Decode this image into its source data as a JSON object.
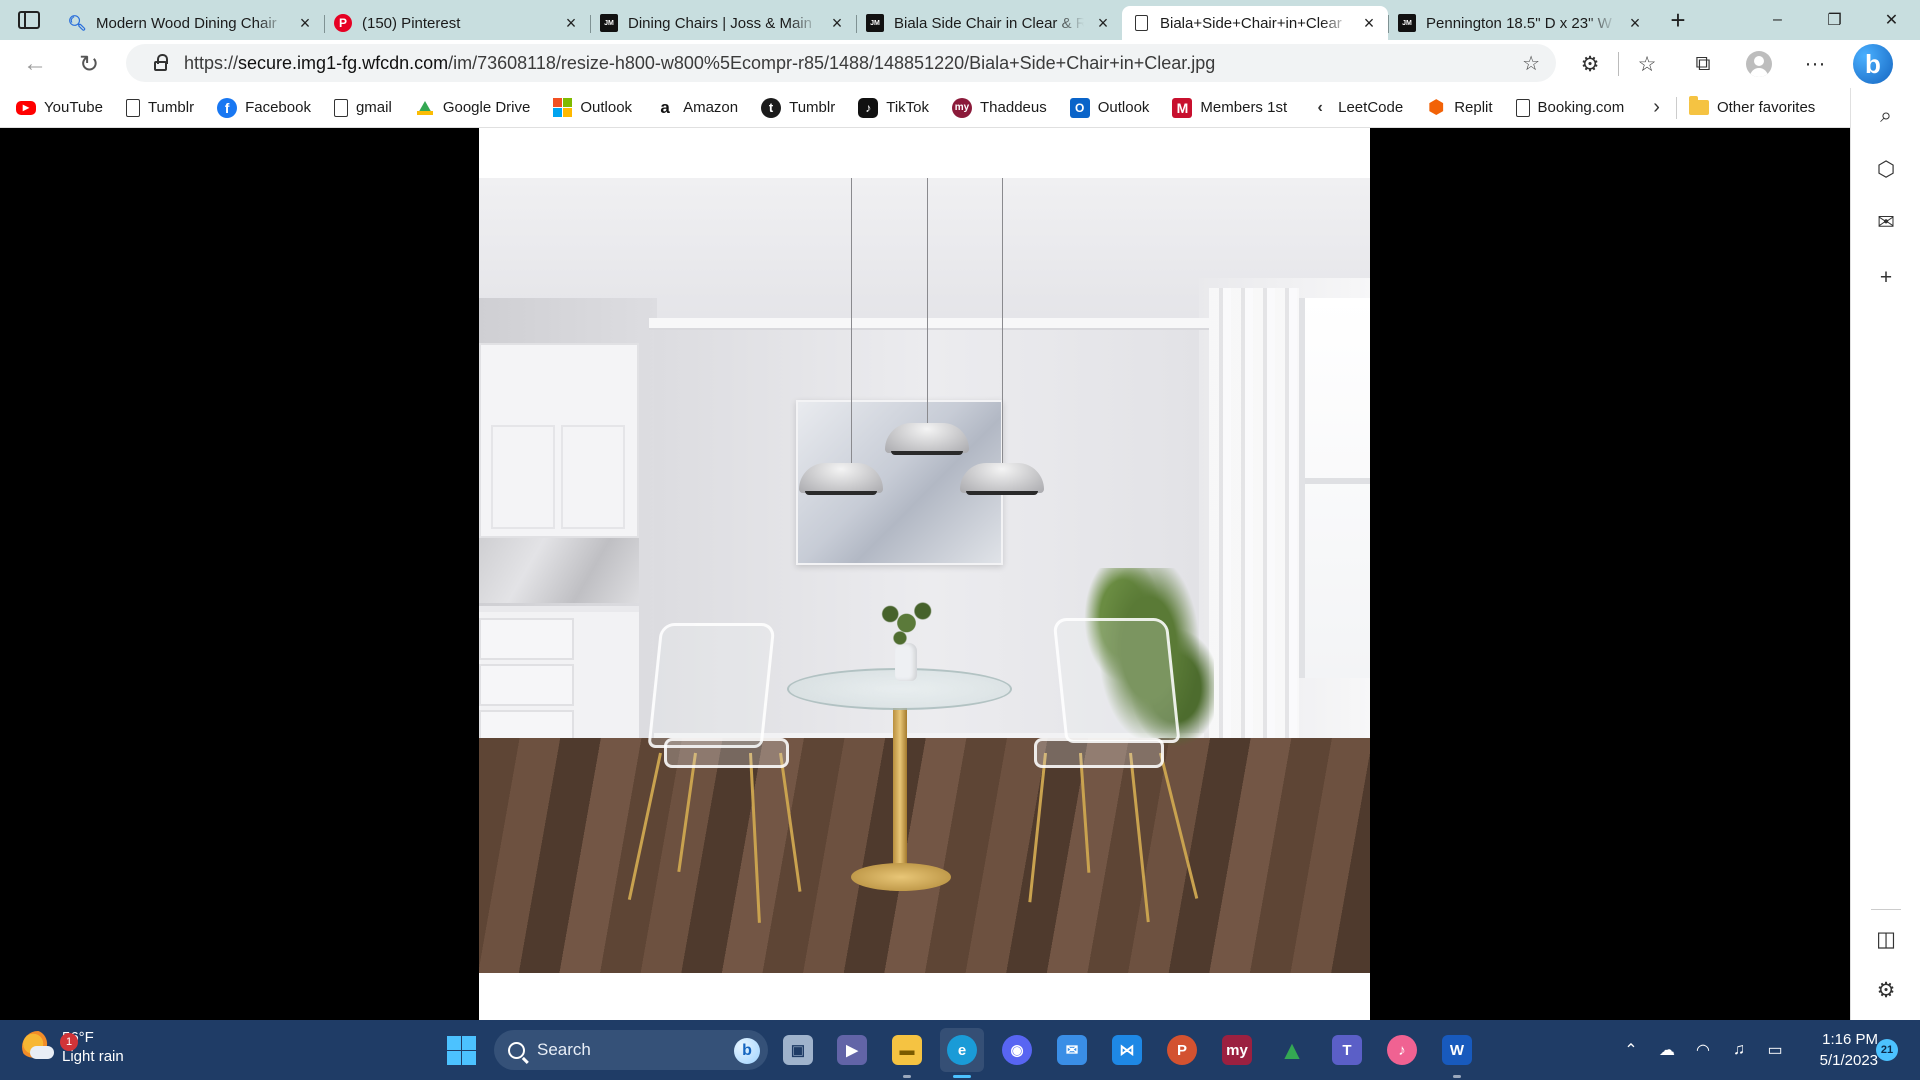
{
  "browser": {
    "tabs": [
      {
        "title": "Modern Wood Dining Chair",
        "favicon": "search-icon",
        "active": false
      },
      {
        "title": "(150) Pinterest",
        "favicon": "pinterest-icon",
        "active": false
      },
      {
        "title": "Dining Chairs | Joss & Main",
        "favicon": "joss-main-icon",
        "active": false
      },
      {
        "title": "Biala Side Chair in Clear & R",
        "favicon": "joss-main-icon",
        "active": false
      },
      {
        "title": "Biala+Side+Chair+in+Clear",
        "favicon": "document-icon",
        "active": true
      },
      {
        "title": "Pennington 18.5\" D x 23\" W",
        "favicon": "joss-main-icon",
        "active": false
      }
    ],
    "new_tab": "+",
    "window_controls": {
      "minimize": "–",
      "restore": "❐",
      "close": "✕"
    },
    "address": {
      "prefix": "https://",
      "host": "secure.img1-fg.wfcdn.com",
      "path": "/im/73608118/resize-h800-w800%5Ecompr-r85/1488/148851220/Biala+Side+Chair+in+Clear.jpg"
    },
    "favorites": [
      {
        "label": "YouTube",
        "icon": "youtube-icon"
      },
      {
        "label": "Tumblr",
        "icon": "document-icon"
      },
      {
        "label": "Facebook",
        "icon": "facebook-icon"
      },
      {
        "label": "gmail",
        "icon": "document-icon"
      },
      {
        "label": "Google Drive",
        "icon": "google-drive-icon"
      },
      {
        "label": "Outlook",
        "icon": "microsoft-icon"
      },
      {
        "label": "Amazon",
        "icon": "amazon-icon"
      },
      {
        "label": "Tumblr",
        "icon": "tumblr-icon"
      },
      {
        "label": "TikTok",
        "icon": "tiktok-icon"
      },
      {
        "label": "Thaddeus",
        "icon": "my-icon"
      },
      {
        "label": "Outlook",
        "icon": "outlook-icon"
      },
      {
        "label": "Members 1st",
        "icon": "members-1st-icon"
      },
      {
        "label": "LeetCode",
        "icon": "leetcode-icon"
      },
      {
        "label": "Replit",
        "icon": "replit-icon"
      },
      {
        "label": "Booking.com",
        "icon": "document-icon"
      }
    ],
    "other_favorites": "Other favorites"
  },
  "taskbar": {
    "weather": {
      "temp": "56°F",
      "condition": "Light rain",
      "badge": "1"
    },
    "search_placeholder": "Search",
    "clock": {
      "time": "1:16 PM",
      "date": "5/1/2023"
    },
    "notifications": "21",
    "apps": [
      {
        "name": "task-view",
        "glyph": "▣",
        "color": "#9fb3cc"
      },
      {
        "name": "teams-meet",
        "glyph": "▶",
        "color": "#6264a7"
      },
      {
        "name": "file-explorer",
        "glyph": "▬",
        "color": "#f5c342"
      },
      {
        "name": "edge",
        "glyph": "e",
        "color": "#1a9bd7"
      },
      {
        "name": "discord",
        "glyph": "◉",
        "color": "#5865f2"
      },
      {
        "name": "mail",
        "glyph": "✉",
        "color": "#3a8ee6"
      },
      {
        "name": "vscode",
        "glyph": "⋈",
        "color": "#1e88e5"
      },
      {
        "name": "powerpoint",
        "glyph": "P",
        "color": "#d35230"
      },
      {
        "name": "my-app",
        "glyph": "my",
        "color": "#9b2040"
      },
      {
        "name": "google-drive",
        "glyph": "▲",
        "color": "#34a853"
      },
      {
        "name": "teams",
        "glyph": "T",
        "color": "#5b5fc7"
      },
      {
        "name": "itunes",
        "glyph": "♪",
        "color": "#f06292"
      },
      {
        "name": "word",
        "glyph": "W",
        "color": "#185abd"
      }
    ]
  }
}
